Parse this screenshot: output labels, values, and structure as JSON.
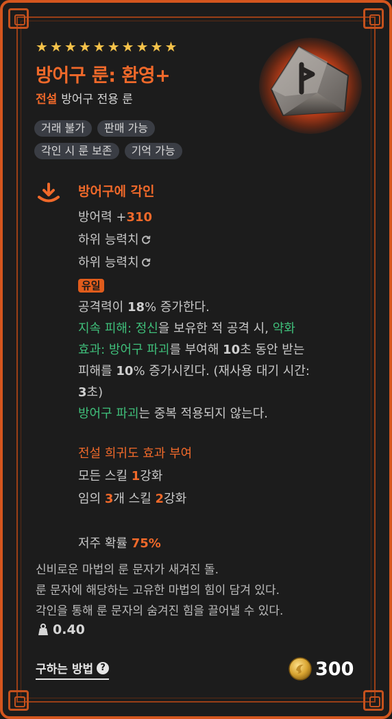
{
  "item": {
    "stars": [
      "★",
      "★",
      "★",
      "★",
      "★",
      "★",
      "★",
      "★",
      "★",
      "★"
    ],
    "name": "방어구 룬: 환영+",
    "grade": "전설",
    "type": "방어구 전용 룬",
    "tags": [
      [
        "거래 불가",
        "판매 가능"
      ],
      [
        "각인 시 룬 보존",
        "기억 가능"
      ]
    ]
  },
  "imprint": {
    "title": "방어구에 각인",
    "defense_label": "방어력 +",
    "defense_value": "310",
    "sub_stat_1": "하위 능력치",
    "sub_stat_2": "하위 능력치",
    "unique_badge": "유일",
    "effect": {
      "l1_a": "공격력이 ",
      "l1_b": "18",
      "l1_c": "% 증가한다.",
      "l2_green": "지속 피해: 정신",
      "l2_rest": "을 보유한 적 공격 시, ",
      "l2_green2": "약화",
      "l3_green": "효과: 방어구 파괴",
      "l3_a": "를 부여해 ",
      "l3_b": "10",
      "l3_c": "초 동안 받는",
      "l4_a": "피해를 ",
      "l4_b": "10",
      "l4_c": "% 증가시킨다. (재사용 대기 시간:",
      "l5_a": "3",
      "l5_b": "초)",
      "l6_green": "방어구 파괴",
      "l6_rest": "는 중복 적용되지 않는다."
    },
    "legendary": {
      "title": "전설 희귀도 효과 부여",
      "l1_a": "모든 스킬 ",
      "l1_b": "1",
      "l1_c": "강화",
      "l2_a": "임의 ",
      "l2_b": "3",
      "l2_c": "개 스킬 ",
      "l2_d": "2",
      "l2_e": "강화"
    },
    "curse_label": "저주 확률 ",
    "curse_value": "75%"
  },
  "lore": [
    "신비로운 마법의 룬 문자가 새겨진 돌.",
    "룬 문자에 해당하는 고유한 마법의 힘이 담겨 있다.",
    "각인을 통해 룬 문자의 숨겨진 힘을 끌어낼 수 있다."
  ],
  "weight": "0.40",
  "how_to_obtain": "구하는 방법",
  "help_symbol": "?",
  "price": "300",
  "colors": {
    "accent": "#f0692a",
    "green": "#3fbf7a",
    "frame": "#d4561e",
    "star": "#f5c24a"
  },
  "icons": {
    "rune": "rune-stone-icon",
    "imprint": "imprint-arrow-icon",
    "weight": "weight-icon",
    "coin": "gold-coin-icon",
    "refresh": "reroll-icon"
  }
}
